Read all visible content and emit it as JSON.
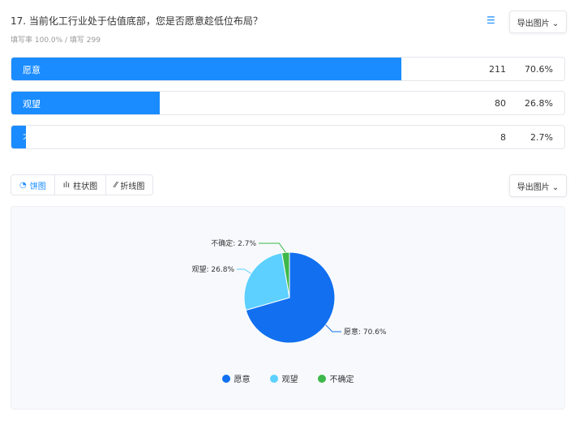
{
  "question": {
    "title": "17. 当前化工行业处于估值底部，您是否愿意趁低位布局？",
    "meta": "填写率 100.0% / 填写 299",
    "export_label": "导出图片 ⌄"
  },
  "tabs": [
    {
      "label": "饼图",
      "icon": "pie-icon"
    },
    {
      "label": "柱状图",
      "icon": "bar-icon"
    },
    {
      "label": "折线图",
      "icon": "line-icon"
    }
  ],
  "colors": {
    "accent": "#1a8cff",
    "slices": [
      "#1270f0",
      "#5dd0ff",
      "#3db84a"
    ]
  },
  "chart_data": {
    "type": "pie",
    "categories": [
      "愿意",
      "观望",
      "不确定"
    ],
    "counts": [
      211,
      80,
      8
    ],
    "percents": [
      "70.6%",
      "26.8%",
      "2.7%"
    ],
    "values": [
      70.6,
      26.8,
      2.7
    ],
    "labels": [
      "愿意: 70.6%",
      "观望: 26.8%",
      "不确定: 2.7%"
    ],
    "legend": "bottom"
  }
}
